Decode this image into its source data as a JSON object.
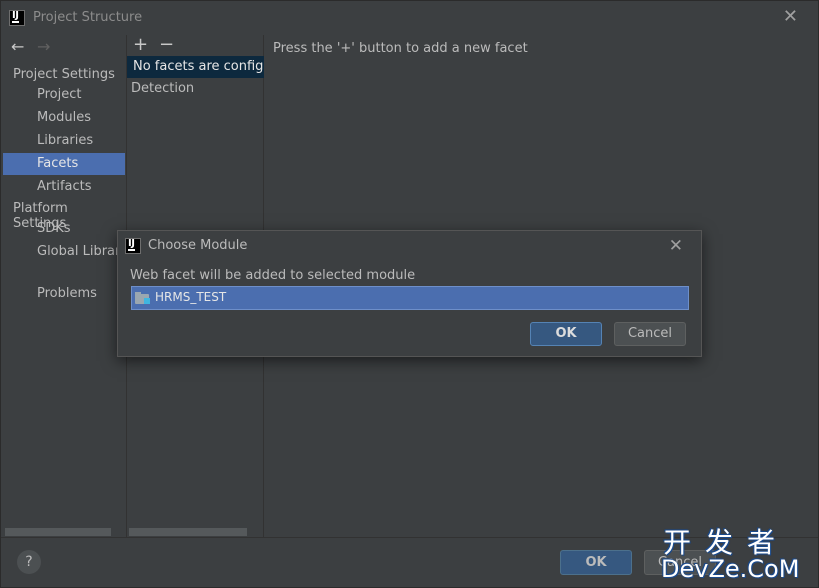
{
  "window": {
    "title": "Project Structure",
    "icons": {
      "app": "intellij-icon",
      "close": "close-icon"
    }
  },
  "sidebar": {
    "nav": {
      "back": "←",
      "forward": "→"
    },
    "project_settings_label": "Project Settings",
    "items": [
      {
        "label": "Project"
      },
      {
        "label": "Modules"
      },
      {
        "label": "Libraries"
      },
      {
        "label": "Facets",
        "selected": true
      },
      {
        "label": "Artifacts"
      }
    ],
    "platform_settings_label": "Platform Settings",
    "platform_items": [
      {
        "label": "SDKs"
      },
      {
        "label": "Global Libraries"
      }
    ],
    "problems_label": "Problems"
  },
  "facets_panel": {
    "add_label": "+",
    "remove_label": "−",
    "selected_item": "No facets are configured",
    "detection_label": "Detection"
  },
  "main": {
    "hint": "Press the '+' button to add a new facet"
  },
  "bottom": {
    "help_label": "?",
    "ok_label": "OK",
    "cancel_label": "Cancel"
  },
  "dialog": {
    "title": "Choose Module",
    "message": "Web facet will be added to selected module",
    "modules": [
      {
        "label": "HRMS_TEST",
        "selected": true
      }
    ],
    "ok_label": "OK",
    "cancel_label": "Cancel"
  },
  "watermark": {
    "cn": "开发者",
    "en": "DevZe.CoM"
  },
  "colors": {
    "background": "#3c3f41",
    "selection": "#4b6eaf",
    "selection_inactive": "#0d293e",
    "primary_button": "#365880"
  }
}
